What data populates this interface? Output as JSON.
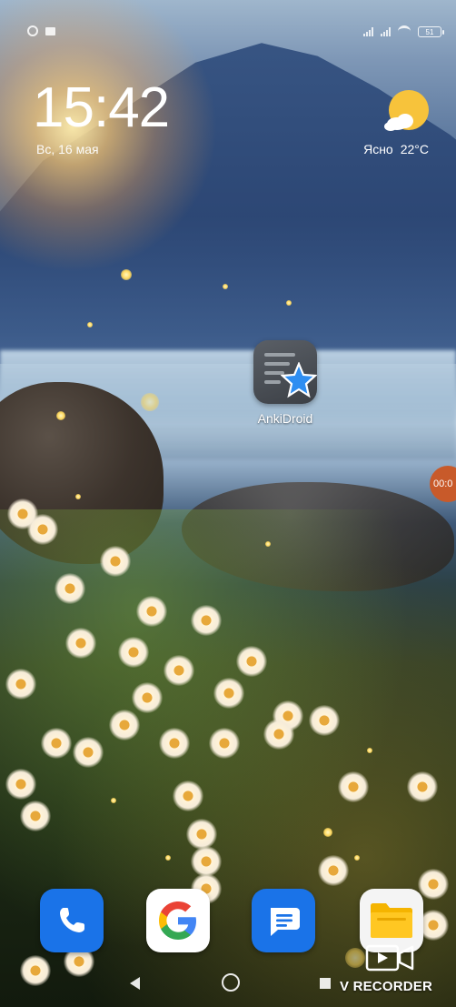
{
  "status_bar": {
    "battery_level": "51"
  },
  "lockscreen": {
    "time": "15:42",
    "date": "Вс, 16 мая"
  },
  "weather": {
    "condition": "Ясно",
    "temperature": "22°C",
    "icon": "sun-cloud-icon"
  },
  "home_apps": [
    {
      "label": "AnkiDroid",
      "icon": "ankidroid-icon"
    }
  ],
  "dock": [
    {
      "icon": "phone-icon"
    },
    {
      "icon": "google-icon"
    },
    {
      "icon": "messages-icon"
    },
    {
      "icon": "files-icon"
    }
  ],
  "recorder": {
    "bubble_text": "00:0",
    "label": "V RECORDER",
    "accent_color": "#c85a2a"
  },
  "colors": {
    "google_blue": "#1a73e8",
    "sun_yellow": "#f7c33b"
  }
}
